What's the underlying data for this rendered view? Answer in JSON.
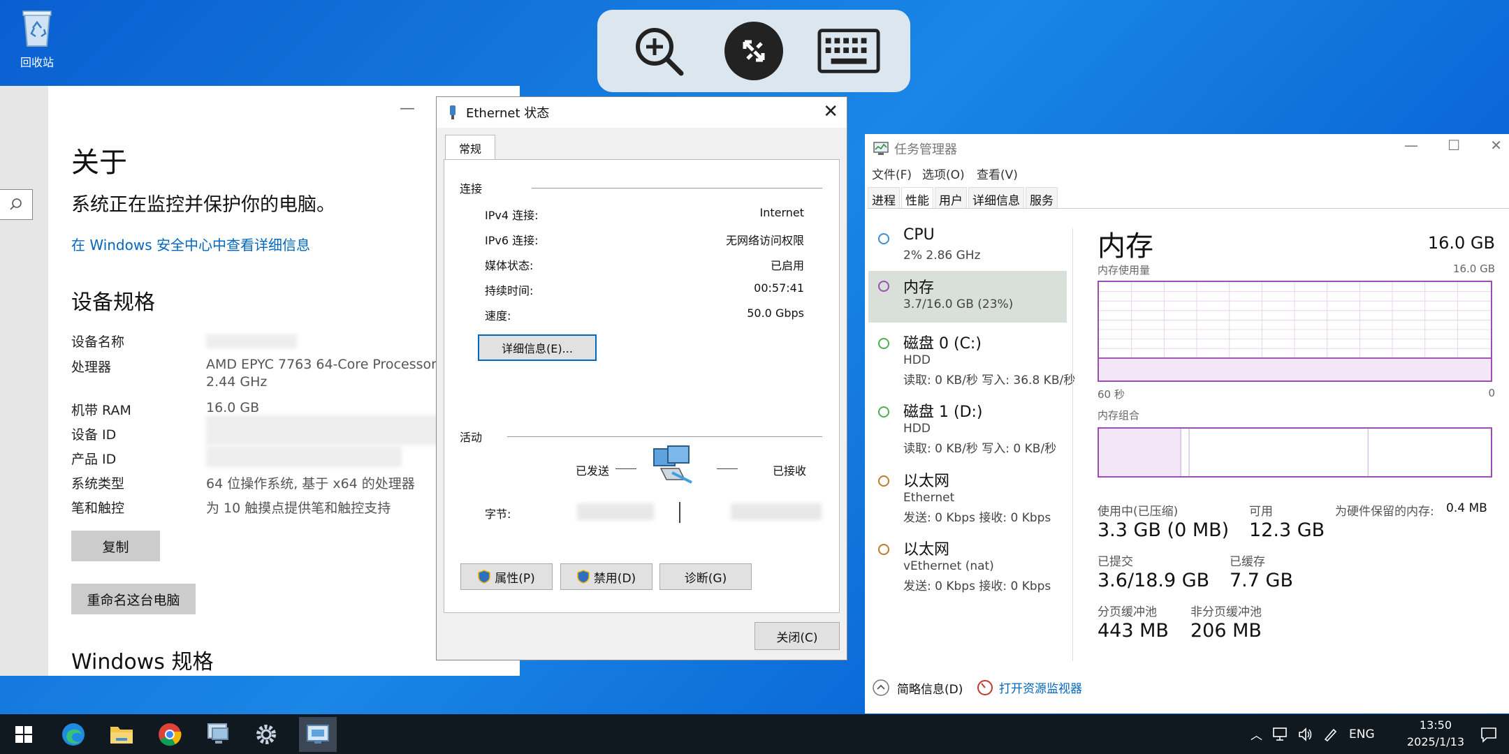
{
  "desktop": {
    "recycle_label": "回收站"
  },
  "remote_toolbar": {
    "zoom_icon": "zoom-in-icon",
    "connect_icon": "remote-icon",
    "keyboard_icon": "keyboard-icon"
  },
  "about": {
    "title": "关于",
    "message": "系统正在监控并保护你的电脑。",
    "security_link": "在 Windows 安全中心中查看详细信息",
    "device_spec_heading": "设备规格",
    "specs": [
      {
        "label": "设备名称",
        "value": ""
      },
      {
        "label": "处理器",
        "value": "AMD EPYC 7763 64-Core Processor",
        "value2": "2.44 GHz"
      },
      {
        "label": "机带 RAM",
        "value": "16.0 GB"
      },
      {
        "label": "设备 ID",
        "value": ""
      },
      {
        "label": "产品 ID",
        "value": ""
      },
      {
        "label": "系统类型",
        "value": "64 位操作系统, 基于 x64 的处理器"
      },
      {
        "label": "笔和触控",
        "value": "为 10 触摸点提供笔和触控支持"
      }
    ],
    "copy_button": "复制",
    "rename_button": "重命名这台电脑",
    "windows_spec_heading": "Windows 规格"
  },
  "ethernet": {
    "title": "Ethernet 状态",
    "tab": "常规",
    "connection_group": "连接",
    "rows": [
      {
        "label": "IPv4 连接:",
        "value": "Internet"
      },
      {
        "label": "IPv6 连接:",
        "value": "无网络访问权限"
      },
      {
        "label": "媒体状态:",
        "value": "已启用"
      },
      {
        "label": "持续时间:",
        "value": "00:57:41"
      },
      {
        "label": "速度:",
        "value": "50.0 Gbps"
      }
    ],
    "details_button": "详细信息(E)...",
    "activity_group": "活动",
    "sent_label": "已发送",
    "received_label": "已接收",
    "bytes_label": "字节:",
    "properties_button": "属性(P)",
    "disable_button": "禁用(D)",
    "diagnose_button": "诊断(G)",
    "close_button": "关闭(C)"
  },
  "taskmgr": {
    "title": "任务管理器",
    "menu": [
      "文件(F)",
      "选项(O)",
      "查看(V)"
    ],
    "tabs": [
      "进程",
      "性能",
      "用户",
      "详细信息",
      "服务"
    ],
    "resources": [
      {
        "name": "CPU",
        "sub1": "2% 2.86 GHz",
        "sub2": "",
        "color": "#3c8ed2"
      },
      {
        "name": "内存",
        "sub1": "3.7/16.0 GB (23%)",
        "sub2": "",
        "color": "#9b4fb0"
      },
      {
        "name": "磁盘 0 (C:)",
        "sub1": "HDD",
        "sub2": "读取: 0 KB/秒 写入: 36.8 KB/秒",
        "color": "#4caf50"
      },
      {
        "name": "磁盘 1 (D:)",
        "sub1": "HDD",
        "sub2": "读取: 0 KB/秒 写入: 0 KB/秒",
        "color": "#4caf50"
      },
      {
        "name": "以太网",
        "sub1": "Ethernet",
        "sub2": "发送: 0 Kbps 接收: 0 Kbps",
        "color": "#c07a2f"
      },
      {
        "name": "以太网",
        "sub1": "vEthernet (nat)",
        "sub2": "发送: 0 Kbps 接收: 0 Kbps",
        "color": "#c07a2f"
      }
    ],
    "detail": {
      "heading": "内存",
      "total": "16.0 GB",
      "usage_label": "内存使用量",
      "usage_max": "16.0 GB",
      "time_left": "60 秒",
      "time_right": "0",
      "composition_label": "内存组合",
      "in_use_label": "使用中(已压缩)",
      "in_use_value": "3.3 GB (0 MB)",
      "available_label": "可用",
      "available_value": "12.3 GB",
      "hw_reserved_label": "为硬件保留的内存:",
      "hw_reserved_value": "0.4 MB",
      "committed_label": "已提交",
      "committed_value": "3.6/18.9 GB",
      "cached_label": "已缓存",
      "cached_value": "7.7 GB",
      "paged_label": "分页缓冲池",
      "paged_value": "443 MB",
      "nonpaged_label": "非分页缓冲池",
      "nonpaged_value": "206 MB"
    },
    "fewer_details": "简略信息(D)",
    "resource_monitor": "打开资源监视器"
  },
  "taskbar": {
    "lang": "ENG",
    "time": "13:50",
    "date": "2025/1/13"
  }
}
